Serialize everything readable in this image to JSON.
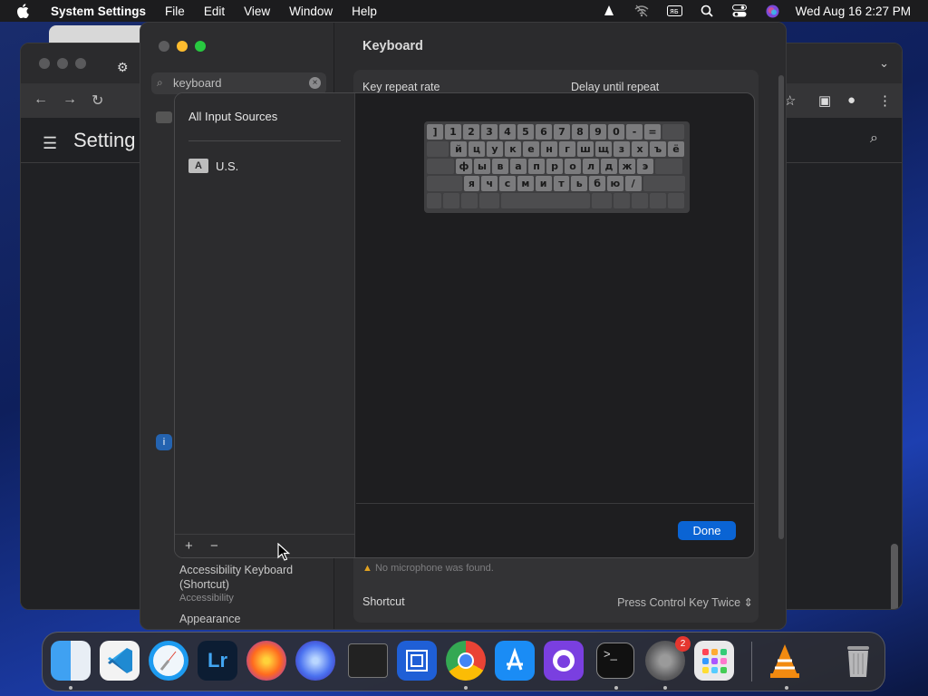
{
  "menubar": {
    "app_name": "System Settings",
    "items": [
      "File",
      "Edit",
      "View",
      "Window",
      "Help"
    ],
    "clock": "Wed Aug 16  2:27 PM"
  },
  "chrome_window": {
    "page_title": "Setting"
  },
  "system_settings": {
    "search_value": "keyboard",
    "pane_title": "Keyboard",
    "key_repeat_label": "Key repeat rate",
    "delay_label": "Delay until repeat",
    "warning": "No microphone was found.",
    "shortcut_label": "Shortcut",
    "shortcut_value": "Press Control Key Twice",
    "sidebar_result_1": "Accessibility Keyboard (Shortcut)",
    "sidebar_result_1_sub": "Accessibility",
    "sidebar_result_2": "Appearance"
  },
  "input_sources_sheet": {
    "all_label": "All Input Sources",
    "source_badge": "A",
    "source_name": "U.S.",
    "add_label": "+",
    "remove_label": "−",
    "done_label": "Done",
    "keyboard_rows": [
      [
        "]",
        "1",
        "2",
        "3",
        "4",
        "5",
        "6",
        "7",
        "8",
        "9",
        "0",
        "-",
        "=",
        ""
      ],
      [
        "",
        "й",
        "ц",
        "у",
        "к",
        "е",
        "н",
        "г",
        "ш",
        "щ",
        "з",
        "х",
        "ъ",
        "ё"
      ],
      [
        "",
        "ф",
        "ы",
        "в",
        "а",
        "п",
        "р",
        "о",
        "л",
        "д",
        "ж",
        "э",
        ""
      ],
      [
        "",
        "я",
        "ч",
        "с",
        "м",
        "и",
        "т",
        "ь",
        "б",
        "ю",
        "/",
        ""
      ]
    ]
  },
  "dock": {
    "apps": [
      "Finder",
      "Visual Studio Code",
      "Safari",
      "Lightroom",
      "Firefox",
      "Firefox Nightly",
      "Console",
      "Remote",
      "Chrome",
      "App Store",
      "GitHub Desktop",
      "Terminal",
      "System Settings",
      "Launchpad",
      "VLC",
      "Trash"
    ],
    "settings_badge": "2"
  }
}
